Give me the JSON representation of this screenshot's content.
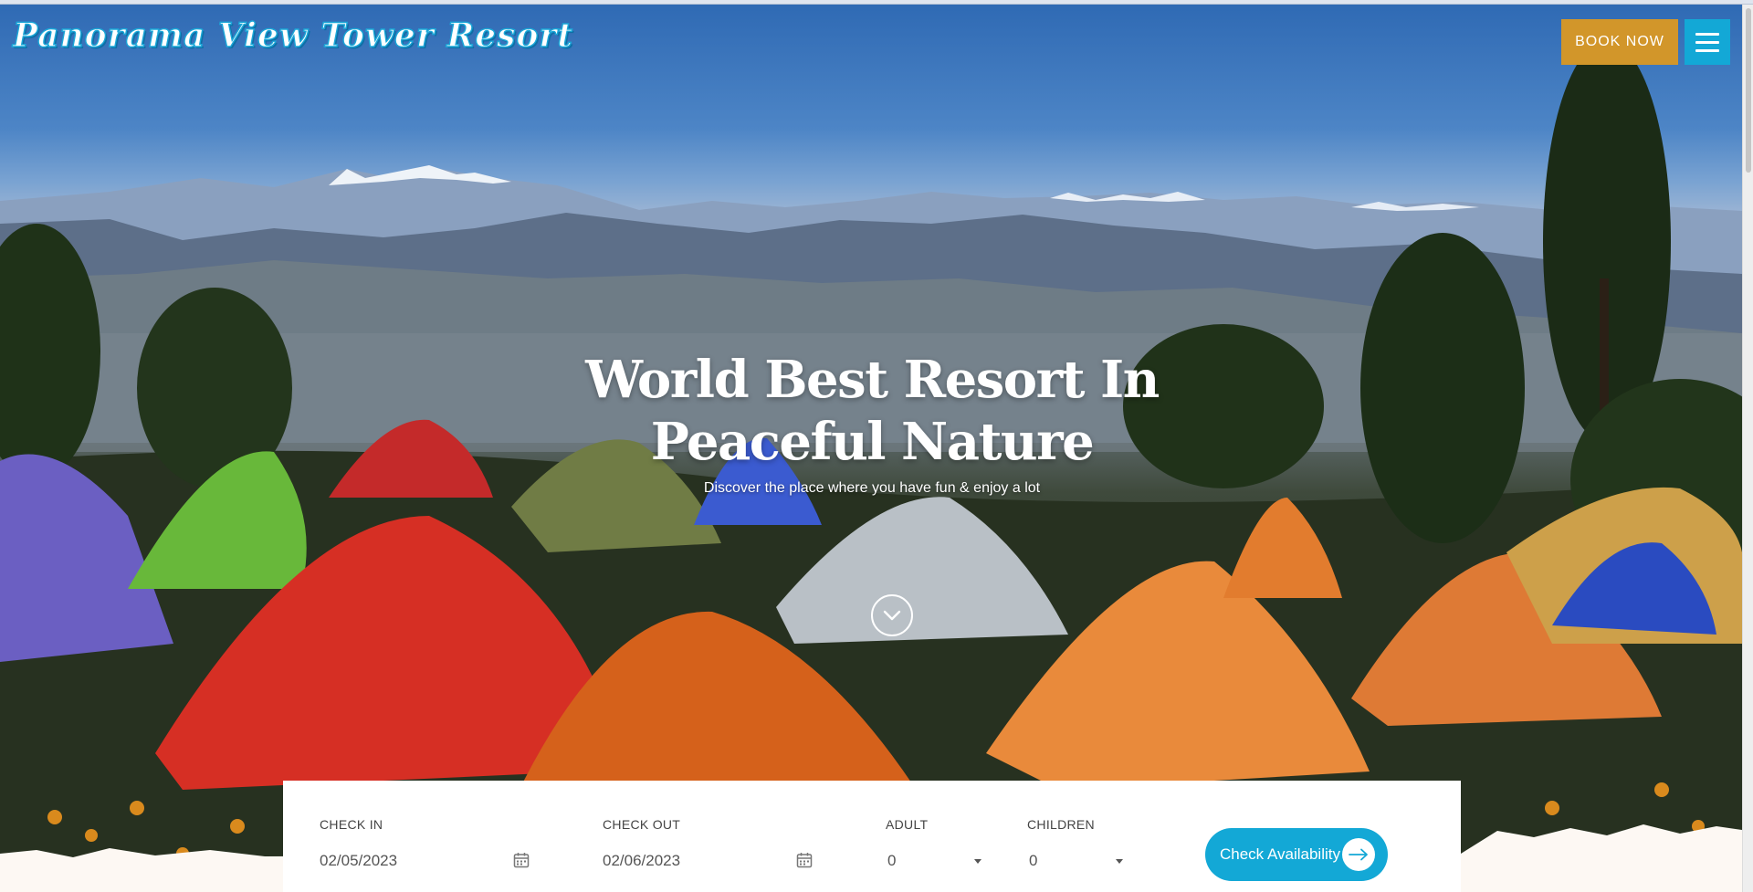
{
  "header": {
    "logo_text": "Panorama View Tower Resort",
    "book_now_label": "BOOK NOW",
    "menu_icon": "hamburger-menu-icon"
  },
  "hero": {
    "title": "World Best Resort In Peaceful Nature",
    "subtitle": "Discover the place where you have fun & enjoy a lot",
    "scroll_icon": "chevron-down-icon"
  },
  "booking": {
    "check_in_label": "CHECK IN",
    "check_in_value": "02/05/2023",
    "check_out_label": "CHECK OUT",
    "check_out_value": "02/06/2023",
    "adult_label": "ADULT",
    "adult_value": "0",
    "children_label": "CHILDREN",
    "children_value": "0",
    "submit_label": "Check Availability",
    "calendar_icon": "calendar-icon",
    "arrow_icon": "arrow-right-icon"
  },
  "colors": {
    "accent_blue": "#13a8d6",
    "book_now_orange": "#d2962a",
    "text_white": "#ffffff"
  }
}
